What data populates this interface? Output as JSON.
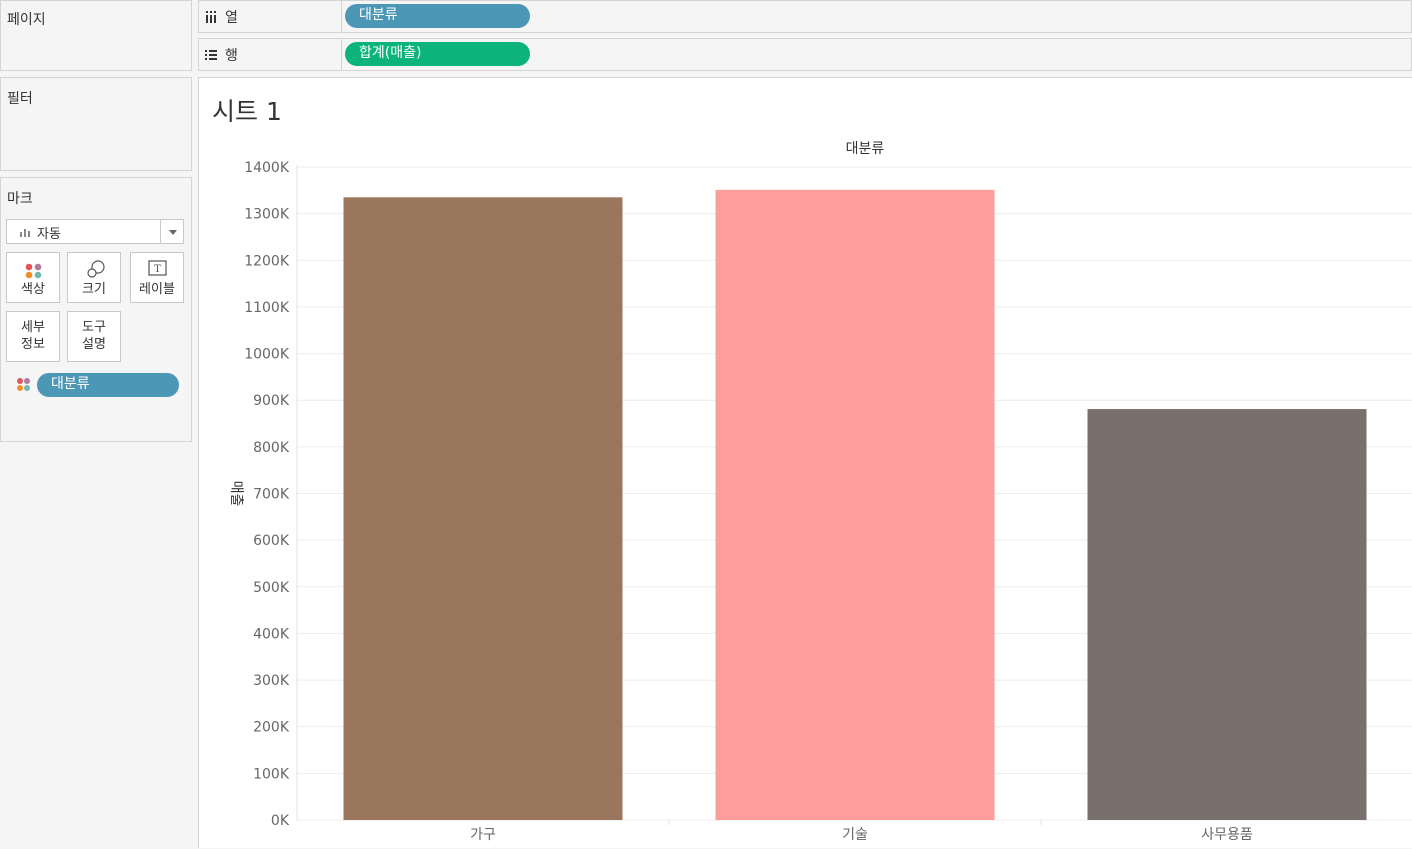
{
  "panels": {
    "pages_title": "페이지",
    "filters_title": "필터",
    "marks_title": "마크"
  },
  "shelves": {
    "columns_label": "열",
    "columns_pill": "대분류",
    "rows_label": "행",
    "rows_pill": "합계(매출)"
  },
  "marks": {
    "type_dropdown": "자동",
    "buttons": {
      "color": "색상",
      "size": "크기",
      "label": "레이블",
      "detail_1": "세부",
      "detail_2": "정보",
      "tooltip_1": "도구",
      "tooltip_2": "설명"
    },
    "color_pill": "대분류"
  },
  "sheet": {
    "title": "시트 1"
  },
  "chart_data": {
    "type": "bar",
    "header": "대분류",
    "ylabel": "매출",
    "categories": [
      "가구",
      "기술",
      "사무용품"
    ],
    "values": [
      1335000,
      1351000,
      881000
    ],
    "colors": [
      "#9a775c",
      "#ff9d9a",
      "#79706e"
    ],
    "ylim": [
      0,
      1400000
    ],
    "yticks": [
      0,
      100000,
      200000,
      300000,
      400000,
      500000,
      600000,
      700000,
      800000,
      900000,
      1000000,
      1100000,
      1200000,
      1300000,
      1400000
    ],
    "ytick_labels": [
      "0K",
      "100K",
      "200K",
      "300K",
      "400K",
      "500K",
      "600K",
      "700K",
      "800K",
      "900K",
      "1000K",
      "1100K",
      "1200K",
      "1300K",
      "1400K"
    ],
    "grid": true,
    "legend": "none"
  }
}
